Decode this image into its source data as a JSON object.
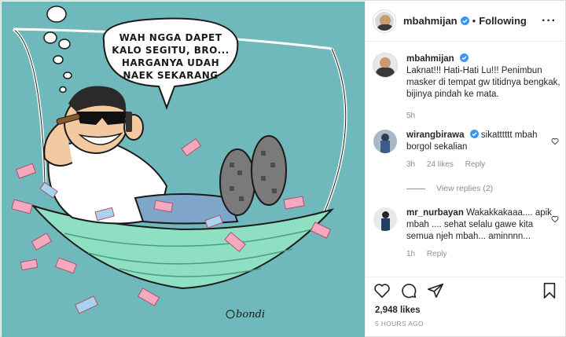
{
  "post": {
    "username": "mbahmijan",
    "separator": "•",
    "follow_state": "Following",
    "more_label": "···"
  },
  "cartoon": {
    "speech_lines": [
      "WAH NGGA DAPET",
      "KALO SEGITU, BRO...",
      "HARGANYA UDAH",
      "NAEK SEKARANG"
    ],
    "signature": "bondi"
  },
  "caption": {
    "username": "mbahmijan",
    "text": "Laknat!!! Hati-Hati Lu!!! Penimbun masker di tempat gw titidnya bengkak, bijinya pindah ke mata.",
    "time": "5h"
  },
  "comments": [
    {
      "username": "wirangbirawa",
      "text": "sikatttttt mbah",
      "text_continued": "borgol sekalian",
      "time": "3h",
      "likes": "24 likes",
      "reply": "Reply"
    },
    {
      "username": "mr_nurbayan",
      "text": "Wakakkakaaa.... apik mbah .... sehat selalu gawe kita semua njeh mbah... aminnnn...",
      "time": "1h",
      "reply": "Reply"
    }
  ],
  "view_replies": "View replies (2)",
  "footer": {
    "likes": "2,948 likes",
    "time_ago": "5 HOURS AGO"
  },
  "icons": [
    "verified-icon",
    "heart-icon",
    "comment-icon",
    "share-icon",
    "bookmark-icon",
    "more-icon"
  ],
  "colors": {
    "verified": "#3897f0",
    "muted": "#8e8e8e",
    "cartoon_bg": "#6fb8bb"
  }
}
